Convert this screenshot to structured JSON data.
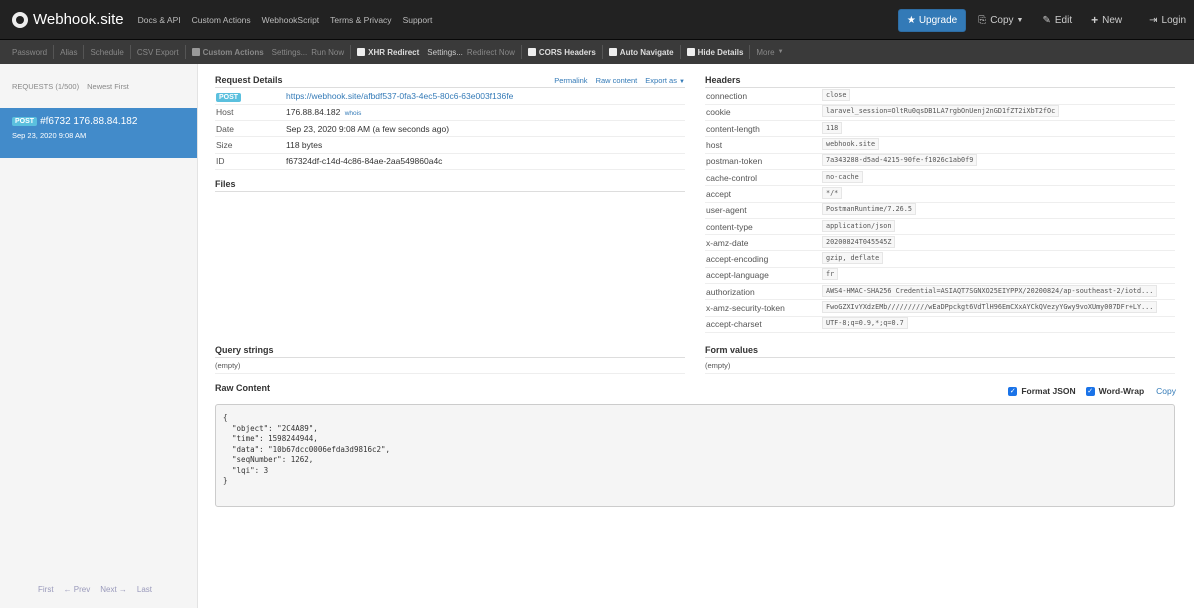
{
  "topnav": {
    "brand": "Webhook.site",
    "links": [
      "Docs & API",
      "Custom Actions",
      "WebhookScript",
      "Terms & Privacy",
      "Support"
    ],
    "upgrade": "Upgrade",
    "copy": "Copy",
    "edit": "Edit",
    "new": "New",
    "login": "Login"
  },
  "toolbar": {
    "password": "Password",
    "alias": "Alias",
    "schedule": "Schedule",
    "csv": "CSV Export",
    "custom_actions": "Custom Actions",
    "custom_settings": "Settings...",
    "run_now": "Run Now",
    "xhr": "XHR Redirect",
    "xhr_settings": "Settings...",
    "redirect_now": "Redirect Now",
    "cors": "CORS Headers",
    "auto_nav": "Auto Navigate",
    "hide_details": "Hide Details",
    "more": "More"
  },
  "sidebar": {
    "requests": "REQUESTS (1/500)",
    "sort": "Newest First",
    "item": {
      "method": "POST",
      "title": "#f6732 176.88.84.182",
      "date": "Sep 23, 2020 9:08 AM"
    },
    "pager": {
      "first": "First",
      "prev": "← Prev",
      "next": "Next →",
      "last": "Last"
    }
  },
  "details": {
    "title": "Request Details",
    "permalink": "Permalink",
    "raw": "Raw content",
    "export": "Export as",
    "method": "POST",
    "url": "https://webhook.site/afbdf537-0fa3-4ec5-80c6-63e003f136fe",
    "rows": [
      {
        "k": "Host",
        "v": "176.88.84.182"
      },
      {
        "k": "Date",
        "v": "Sep 23, 2020 9:08 AM (a few seconds ago)"
      },
      {
        "k": "Size",
        "v": "118 bytes"
      },
      {
        "k": "ID",
        "v": "f67324df-c14d-4c86-84ae-2aa549860a4c"
      }
    ],
    "whois": "whois"
  },
  "files": {
    "title": "Files"
  },
  "headers": {
    "title": "Headers",
    "rows": [
      {
        "k": "connection",
        "v": "close"
      },
      {
        "k": "cookie",
        "v": "laravel_session=OltRu0qsDB1LA7rgbOnUenj2nGD1fZT2iXbT2fOc"
      },
      {
        "k": "content-length",
        "v": "118"
      },
      {
        "k": "host",
        "v": "webhook.site"
      },
      {
        "k": "postman-token",
        "v": "7a343288-d5ad-4215-90fe-f1026c1ab0f9"
      },
      {
        "k": "cache-control",
        "v": "no-cache"
      },
      {
        "k": "accept",
        "v": "*/*"
      },
      {
        "k": "user-agent",
        "v": "PostmanRuntime/7.26.5"
      },
      {
        "k": "content-type",
        "v": "application/json"
      },
      {
        "k": "x-amz-date",
        "v": "20200824T045545Z"
      },
      {
        "k": "accept-encoding",
        "v": "gzip, deflate"
      },
      {
        "k": "accept-language",
        "v": "fr"
      },
      {
        "k": "authorization",
        "v": "AWS4-HMAC-SHA256 Credential=ASIAQT7SGNXO25EIYPPX/20200824/ap-southeast-2/iotd..."
      },
      {
        "k": "x-amz-security-token",
        "v": "FwoGZXIvYXdzEMb//////////wEaDPpckgt6VdTlH96EmCXxAYCkQVezyYGwy9voXUmy007DFr+LY..."
      },
      {
        "k": "accept-charset",
        "v": "UTF-8;q=0.9,*;q=0.7"
      }
    ]
  },
  "query": {
    "title": "Query strings",
    "empty": "(empty)"
  },
  "form": {
    "title": "Form values",
    "empty": "(empty)"
  },
  "raw": {
    "title": "Raw Content",
    "format_json": "Format JSON",
    "word_wrap": "Word-Wrap",
    "copy": "Copy",
    "body": "{\n  \"object\": \"2C4A89\",\n  \"time\": 1598244944,\n  \"data\": \"10b67dcc0006efda3d9816c2\",\n  \"seqNumber\": 1262,\n  \"lqi\": 3\n}"
  }
}
